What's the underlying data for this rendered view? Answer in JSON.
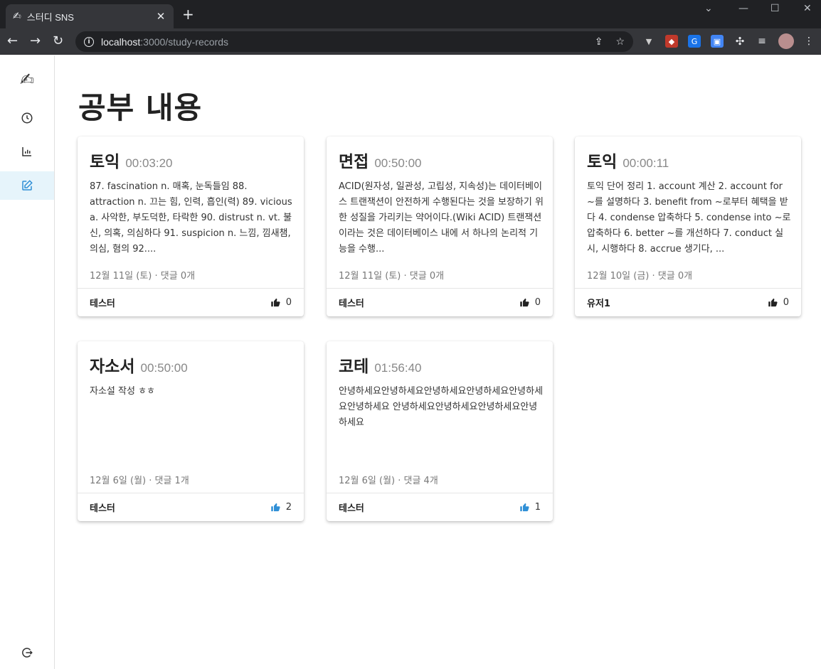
{
  "browser": {
    "tab_title": "스터디 SNS",
    "tab_favicon": "✍",
    "url_host": "localhost",
    "url_path": ":3000/study-records"
  },
  "sidebar": {
    "logo": "✍",
    "items": [
      {
        "name": "history",
        "icon": "clock-icon"
      },
      {
        "name": "stats",
        "icon": "bar-chart-icon"
      },
      {
        "name": "records",
        "icon": "edit-icon",
        "active": true
      }
    ],
    "logout_icon": "logout-icon"
  },
  "page": {
    "title": "공부 내용"
  },
  "colors": {
    "accent": "#2f8fd6",
    "active_bg": "#e6f4fb"
  },
  "cards": [
    {
      "subject": "토익",
      "time": "00:03:20",
      "content": "87. fascination n. 매혹, 눈독들임 88. attraction n. 끄는 힘, 인력, 흡인(력) 89. vicious a. 사악한, 부도덕한, 타락한 90. distrust n. vt. 불신, 의혹, 의심하다 91. suspicion n. 느낌, 낌새챔, 의심, 혐의 92....",
      "meta": "12월 11일 (토) · 댓글 0개",
      "author": "테스터",
      "likes": "0",
      "liked": false
    },
    {
      "subject": "면접",
      "time": "00:50:00",
      "content": "ACID(원자성, 일관성, 고립성, 지속성)는 데이터베이스 트랜잭션이 안전하게 수행된다는 것을 보장하기 위한 성질을 가리키는 약어이다.(Wiki ACID) 트랜잭션이라는 것은 데이터베이스 내에 서 하나의 논리적 기능을 수행...",
      "meta": "12월 11일 (토) · 댓글 0개",
      "author": "테스터",
      "likes": "0",
      "liked": false
    },
    {
      "subject": "토익",
      "time": "00:00:11",
      "content": "토익 단어 정리 1. account 계산 2. account for ~를 설명하다 3. benefit from ~로부터 혜택을 받다 4. condense 압축하다 5. condense into ~로 압축하다 6. better ~를 개선하다 7. conduct 실시, 시행하다 8. accrue 생기다, ...",
      "meta": "12월 10일 (금) · 댓글 0개",
      "author": "유저1",
      "likes": "0",
      "liked": false
    },
    {
      "subject": "자소서",
      "time": "00:50:00",
      "content": "자소설 작성 ㅎㅎ",
      "meta": "12월 6일 (월) · 댓글 1개",
      "author": "테스터",
      "likes": "2",
      "liked": true
    },
    {
      "subject": "코테",
      "time": "01:56:40",
      "content": "안녕하세요안녕하세요안녕하세요안녕하세요안녕하세요안녕하세요 안녕하세요안녕하세요안녕하세요안녕하세요",
      "meta": "12월 6일 (월) · 댓글 4개",
      "author": "테스터",
      "likes": "1",
      "liked": true
    }
  ]
}
